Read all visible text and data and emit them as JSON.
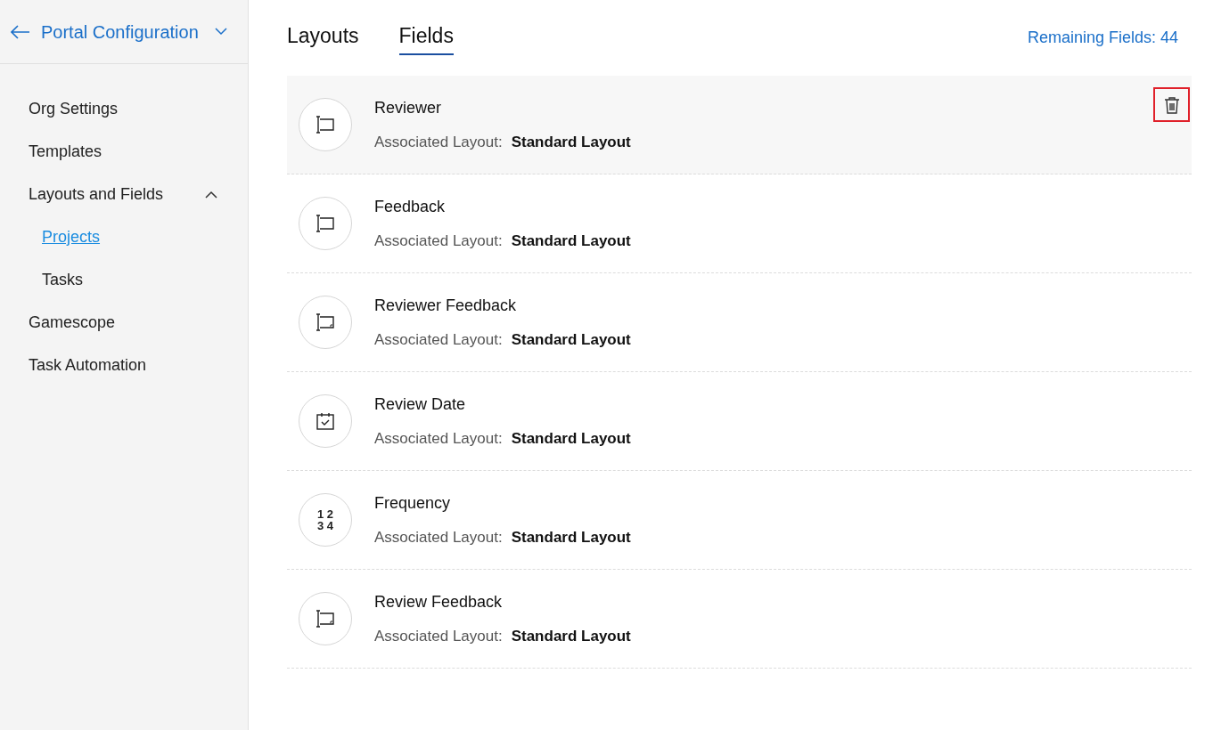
{
  "sidebar": {
    "title": "Portal Configuration",
    "items": [
      {
        "label": "Org Settings",
        "selected": false
      },
      {
        "label": "Templates",
        "selected": false
      },
      {
        "label": "Layouts and Fields",
        "selected": false,
        "expanded": true,
        "children": [
          {
            "label": "Projects",
            "selected": true
          },
          {
            "label": "Tasks",
            "selected": false
          }
        ]
      },
      {
        "label": "Gamescope",
        "selected": false
      },
      {
        "label": "Task Automation",
        "selected": false
      }
    ]
  },
  "tabs": [
    {
      "label": "Layouts",
      "selected": false
    },
    {
      "label": "Fields",
      "selected": true
    }
  ],
  "remaining": "Remaining Fields: 44",
  "fields": [
    {
      "name": "Reviewer",
      "kind": "single-line",
      "layout_label": "Associated Layout:",
      "layout": "Standard Layout",
      "hovered": true
    },
    {
      "name": "Feedback",
      "kind": "single-line",
      "layout_label": "Associated Layout:",
      "layout": "Standard Layout",
      "hovered": false
    },
    {
      "name": "Reviewer Feedback",
      "kind": "multi-line",
      "layout_label": "Associated Layout:",
      "layout": "Standard Layout",
      "hovered": false
    },
    {
      "name": "Review Date",
      "kind": "date",
      "layout_label": "Associated Layout:",
      "layout": "Standard Layout",
      "hovered": false
    },
    {
      "name": "Frequency",
      "kind": "number",
      "icon_text": [
        "1 2",
        "3 4"
      ],
      "layout_label": "Associated Layout:",
      "layout": "Standard Layout",
      "hovered": false
    },
    {
      "name": "Review Feedback",
      "kind": "multi-line",
      "layout_label": "Associated Layout:",
      "layout": "Standard Layout",
      "hovered": false
    }
  ]
}
